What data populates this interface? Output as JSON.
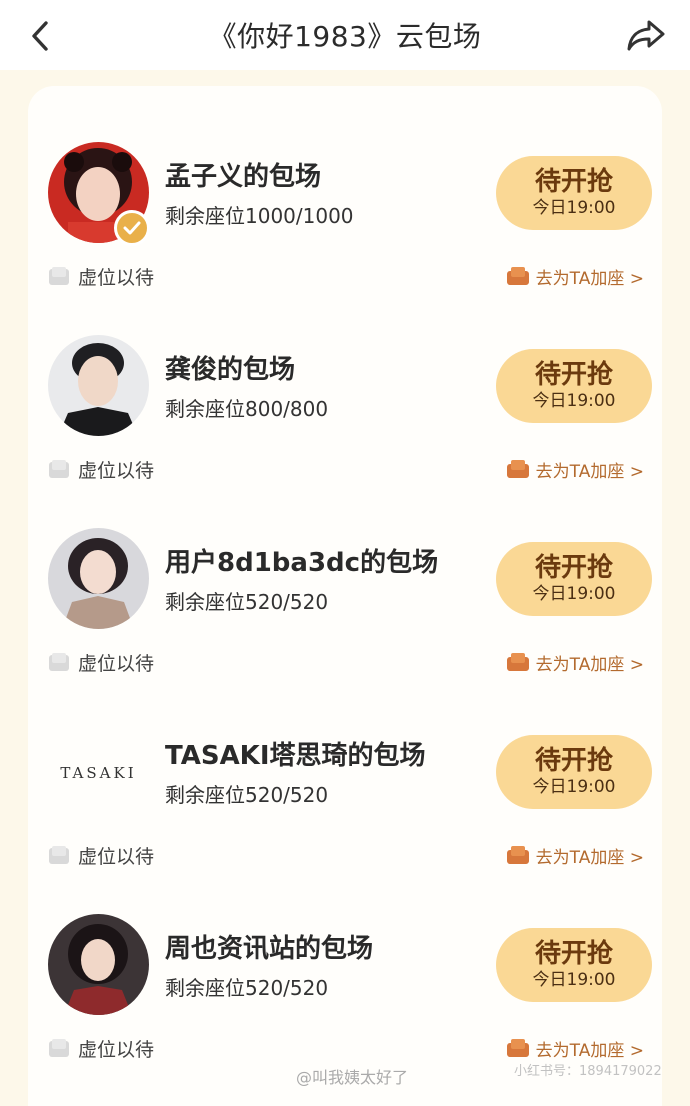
{
  "header": {
    "title": "《你好1983》云包场",
    "back_icon": "back-chevron-icon",
    "share_icon": "share-arrow-icon"
  },
  "colors": {
    "button_bg": "#fad895",
    "button_text": "#6b3a0e",
    "link_text": "#b36a2e",
    "page_bg": "#fdf8ea"
  },
  "items": [
    {
      "name": "孟子义的包场",
      "seats": "剩余座位1000/1000",
      "button_main": "待开抢",
      "button_sub": "今日19:00",
      "left_label": "虚位以待",
      "right_label": "去为TA加座 >",
      "verified": true
    },
    {
      "name": "龚俊的包场",
      "seats": "剩余座位800/800",
      "button_main": "待开抢",
      "button_sub": "今日19:00",
      "left_label": "虚位以待",
      "right_label": "去为TA加座 >"
    },
    {
      "name": "用户8d1ba3dc的包场",
      "seats": "剩余座位520/520",
      "button_main": "待开抢",
      "button_sub": "今日19:00",
      "left_label": "虚位以待",
      "right_label": "去为TA加座 >"
    },
    {
      "name": "TASAKI塔思琦的包场",
      "seats": "剩余座位520/520",
      "button_main": "待开抢",
      "button_sub": "今日19:00",
      "left_label": "虚位以待",
      "right_label": "去为TA加座 >",
      "logo_text": "TASAKI"
    },
    {
      "name": "周也资讯站的包场",
      "seats": "剩余座位520/520",
      "button_main": "待开抢",
      "button_sub": "今日19:00",
      "left_label": "虚位以待",
      "right_label": "去为TA加座 >"
    }
  ],
  "watermark": "@叫我姨太好了",
  "watermark2": "小红书号：1894179022"
}
